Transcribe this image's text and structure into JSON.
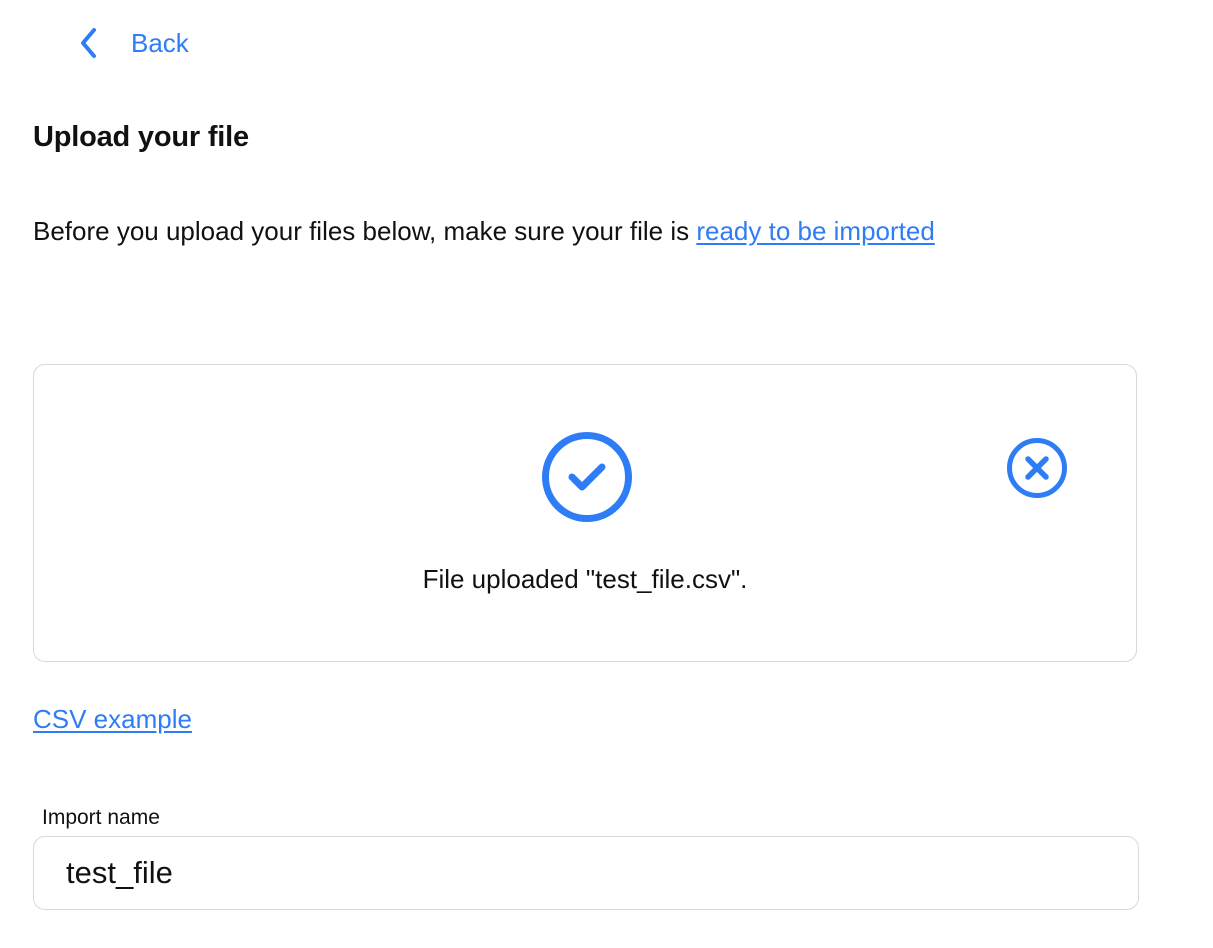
{
  "back": {
    "label": "Back",
    "icon": "chevron-left-icon"
  },
  "page": {
    "title": "Upload your file",
    "intro_text": "Before you upload your files below, make sure your file is ",
    "intro_link": "ready to be imported"
  },
  "upload": {
    "status_icon": "check-circle-icon",
    "remove_icon": "close-circle-icon",
    "status_text": "File uploaded \"test_file.csv\"."
  },
  "csv_example": {
    "label": "CSV example"
  },
  "import_name": {
    "label": "Import name",
    "value": "test_file"
  },
  "colors": {
    "accent": "#2f7df6",
    "border": "#d8d8d8",
    "text": "#111111"
  }
}
